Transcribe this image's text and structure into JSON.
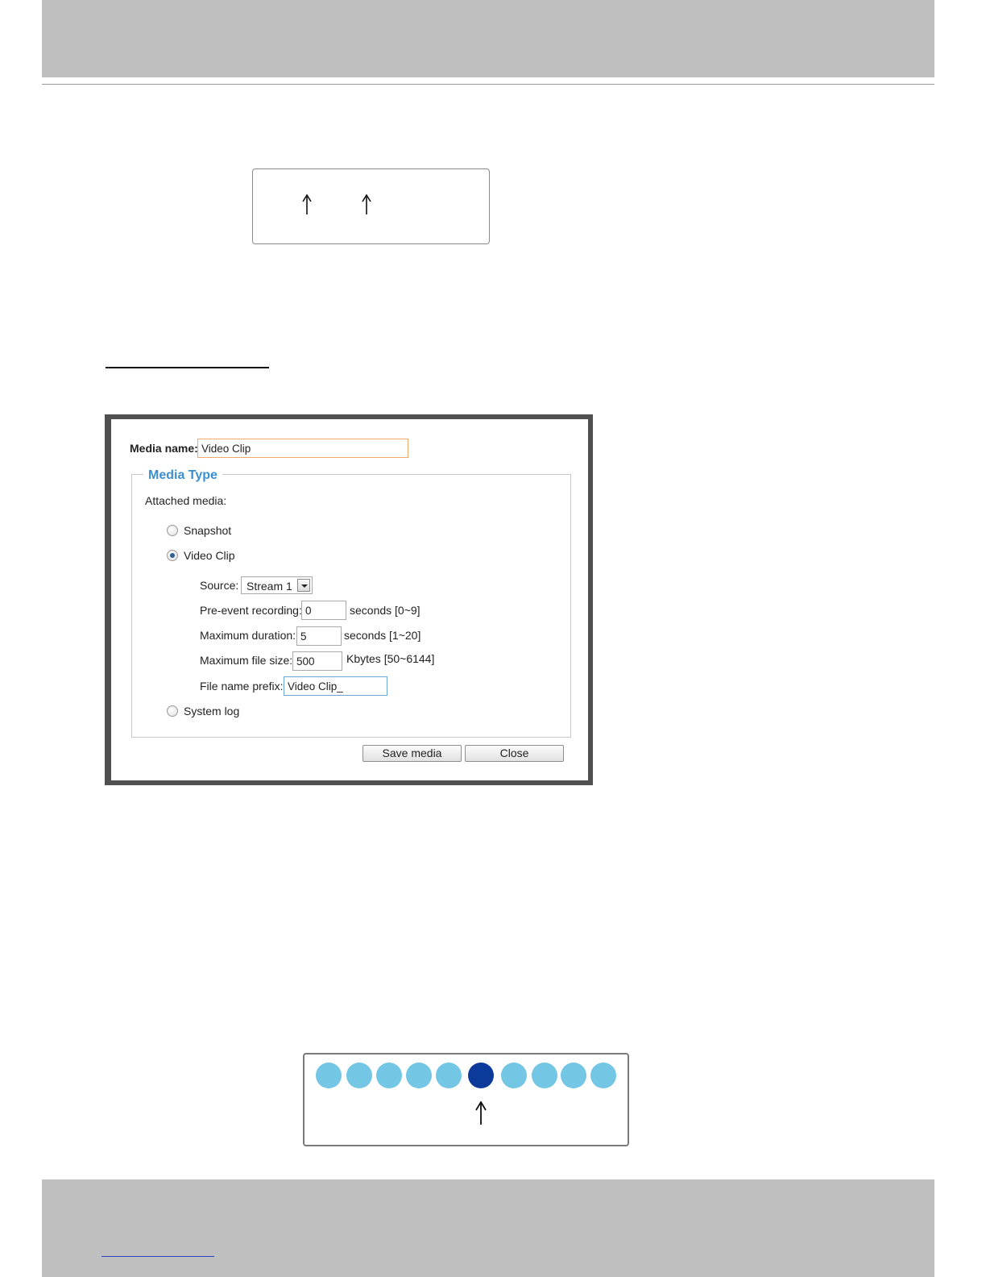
{
  "dialog": {
    "media_name_label": "Media name:",
    "media_name_value": "Video Clip",
    "media_type_legend": "Media Type",
    "attached_media_label": "Attached media:",
    "options": {
      "snapshot": "Snapshot",
      "video_clip": "Video Clip",
      "system_log": "System log"
    },
    "selected_option": "Video Clip",
    "source_label": "Source:",
    "source_value": "Stream 1",
    "pre_event_label": "Pre-event recording:",
    "pre_event_value": "0",
    "pre_event_hint": "seconds [0~9]",
    "max_duration_label": "Maximum duration:",
    "max_duration_value": "5",
    "max_duration_hint": "seconds [1~20]",
    "max_file_size_label": "Maximum file size:",
    "max_file_size_value": "500",
    "max_file_size_hint": "Kbytes [50~6144]",
    "file_prefix_label": "File name prefix:",
    "file_prefix_value": "Video Clip_",
    "save_button": "Save media",
    "close_button": "Close"
  },
  "indicator": {
    "total_dots": 10,
    "active_index": 5,
    "colors": {
      "inactive": "#73c6e4",
      "active": "#0b3a9a"
    }
  },
  "colors": {
    "band": "#bfbfbf",
    "legend": "#3c8fd0",
    "media_name_border": "#f0a96a",
    "prefix_border": "#6aa7d6"
  }
}
